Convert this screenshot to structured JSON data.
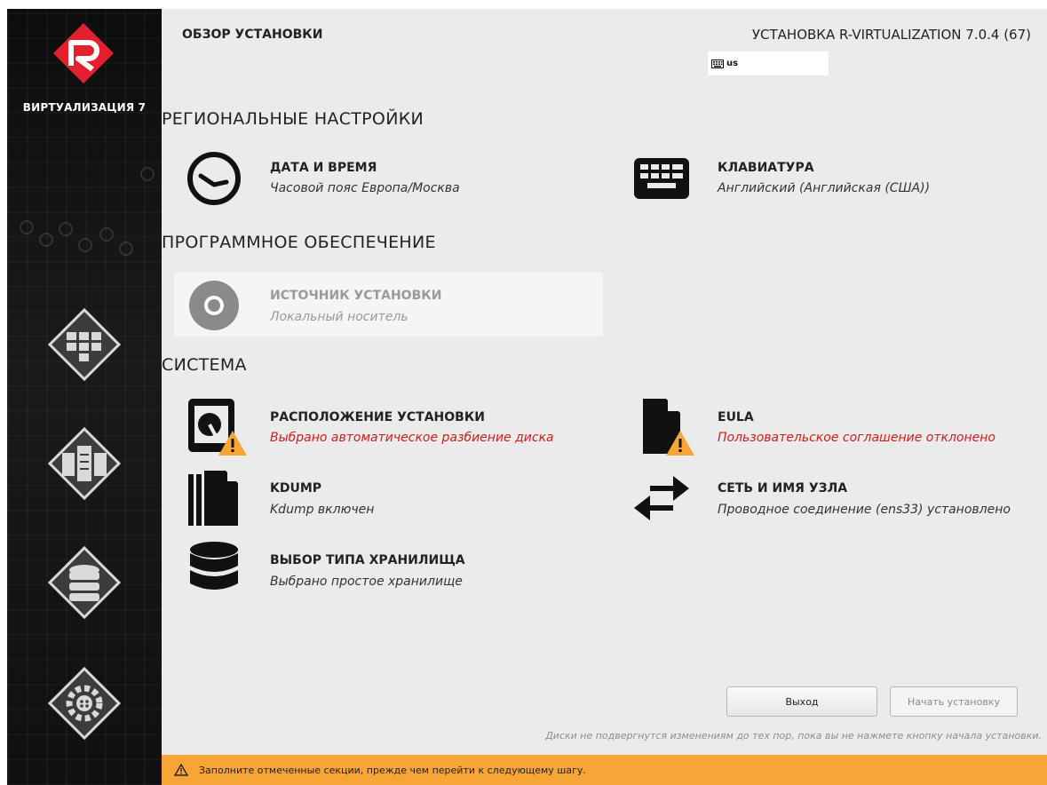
{
  "header": {
    "title": "ОБЗОР УСТАНОВКИ",
    "product": "УСТАНОВКА R-VIRTUALIZATION 7.0.4 (67)",
    "keyboard_layout": "us"
  },
  "sidebar": {
    "product_name": "ВИРТУАЛИЗАЦИЯ 7"
  },
  "sections": {
    "localization": "РЕГИОНАЛЬНЫЕ НАСТРОЙКИ",
    "software": "ПРОГРАММНОЕ ОБЕСПЕЧЕНИЕ",
    "system": "СИСТЕМА"
  },
  "spokes": {
    "datetime": {
      "name": "ДАТА И ВРЕМЯ",
      "status": "Часовой пояс Европа/Москва"
    },
    "keyboard": {
      "name": "КЛАВИАТУРА",
      "status": "Английский (Английская (США))"
    },
    "source": {
      "name": "ИСТОЧНИК УСТАНОВКИ",
      "status": "Локальный носитель"
    },
    "destination": {
      "name": "РАСПОЛОЖЕНИЕ УСТАНОВКИ",
      "status": "Выбрано автоматическое разбиение диска"
    },
    "eula": {
      "name": "EULA",
      "status": "Пользовательское соглашение отклонено"
    },
    "kdump": {
      "name": "KDUMP",
      "status": "Kdump включен"
    },
    "network": {
      "name": "СЕТЬ И ИМЯ УЗЛА",
      "status": "Проводное соединение (ens33) установлено"
    },
    "storage": {
      "name": "ВЫБОР ТИПА ХРАНИЛИЩА",
      "status": "Выбрано простое хранилище"
    }
  },
  "buttons": {
    "quit": "Выход",
    "begin": "Начать установку"
  },
  "notice": "Диски не подвергнутся изменениям до тех пор, пока вы не нажмете кнопку начала установки.",
  "warning_bar": "Заполните отмеченные секции, прежде чем перейти к следующему шагу.",
  "colors": {
    "warning": "#f6a536",
    "error_text": "#d21b1b",
    "logo": "#e5202e"
  }
}
